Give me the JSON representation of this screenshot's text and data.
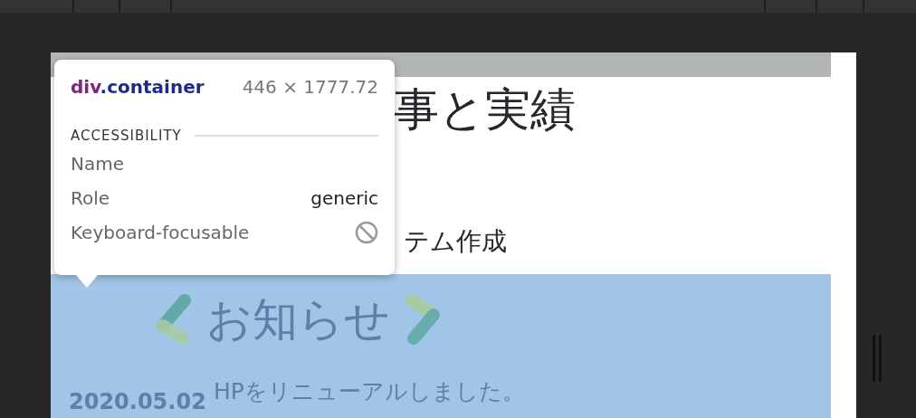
{
  "page": {
    "heading": "事と実績",
    "subheading": "テム作成",
    "news": {
      "title": "お知らせ",
      "items": [
        {
          "date": "2020.05.02",
          "text": "HPをリニューアルしました。"
        }
      ]
    }
  },
  "inspector_tooltip": {
    "tag": "div",
    "class_name": ".container",
    "size": "446 × 1777.72",
    "section": "ACCESSIBILITY",
    "rows": [
      {
        "kind": "text",
        "label": "Name"
      },
      {
        "kind": "text",
        "label": "Role",
        "value": "generic"
      },
      {
        "kind": "icon",
        "label": "Keyboard-focusable"
      }
    ]
  }
}
